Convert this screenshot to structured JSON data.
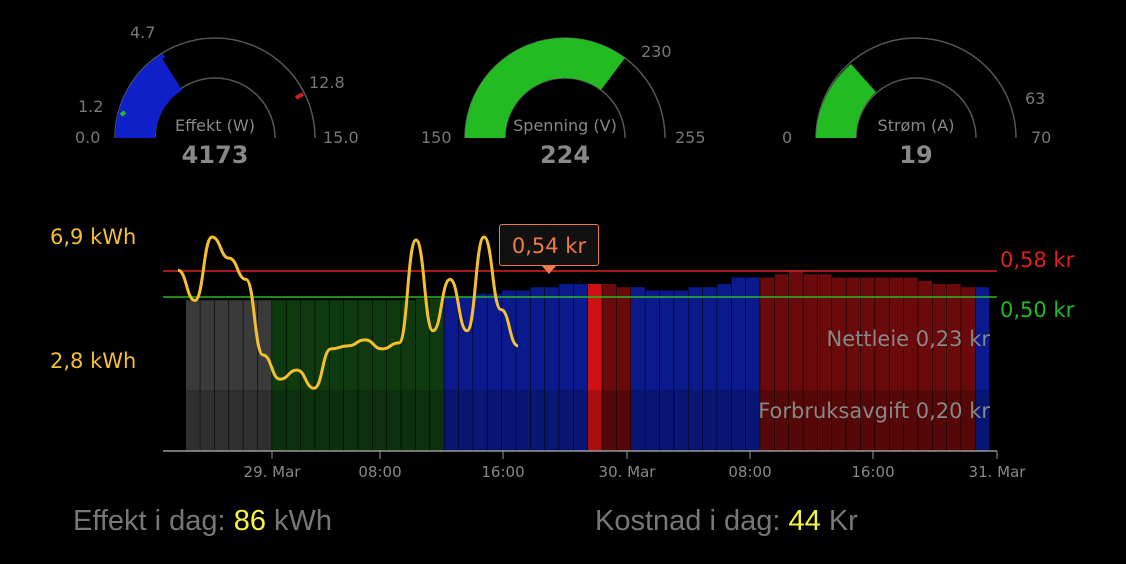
{
  "gauges": [
    {
      "name": "Effekt (W)",
      "value": "4173",
      "min_label": "0.0",
      "max_label": "15.0",
      "ticks": [
        "1.2",
        "4.7",
        "12.8"
      ],
      "fill_fraction": 0.278,
      "color": "#1020c8"
    },
    {
      "name": "Spenning (V)",
      "value": "224",
      "min_label": "150",
      "max_label": "255",
      "ticks": [
        "230"
      ],
      "fill_fraction": 0.705,
      "color": "#22bb22"
    },
    {
      "name": "Strøm (A)",
      "value": "19",
      "min_label": "0",
      "max_label": "70",
      "ticks": [
        "63"
      ],
      "fill_fraction": 0.271,
      "color": "#22bb22"
    }
  ],
  "chart_data": {
    "type": "bar",
    "y_labels_left": [
      "6,9 kWh",
      "2,8 kWh"
    ],
    "price_lines": [
      {
        "label": "0,58 kr",
        "value": 0.58,
        "color": "#e02020"
      },
      {
        "label": "0,50 kr",
        "value": 0.5,
        "color": "#22bb22"
      }
    ],
    "tooltip": "0,54 kr",
    "stack_labels": [
      "Nettleie 0,23 kr",
      "Forbruksavgift 0,20 kr"
    ],
    "x_ticks": [
      "29. Mar",
      "08:00",
      "16:00",
      "30. Mar",
      "08:00",
      "16:00",
      "31. Mar"
    ],
    "price_bars": [
      0.49,
      0.49,
      0.49,
      0.49,
      0.49,
      0.49,
      0.49,
      0.49,
      0.49,
      0.49,
      0.49,
      0.49,
      0.49,
      0.49,
      0.49,
      0.49,
      0.495,
      0.495,
      0.5,
      0.5,
      0.51,
      0.51,
      0.52,
      0.52,
      0.53,
      0.53,
      0.54,
      0.54,
      0.54,
      0.54,
      0.53,
      0.53,
      0.52,
      0.52,
      0.52,
      0.53,
      0.53,
      0.54,
      0.56,
      0.56,
      0.56,
      0.57,
      0.58,
      0.57,
      0.57,
      0.56,
      0.56,
      0.56,
      0.56,
      0.56,
      0.56,
      0.55,
      0.54,
      0.54,
      0.53,
      0.53
    ],
    "bar_colors": [
      "gray",
      "gray",
      "gray",
      "gray",
      "gray",
      "gray",
      "green",
      "green",
      "green",
      "green",
      "green",
      "green",
      "green",
      "green",
      "green",
      "green",
      "green",
      "green",
      "blue",
      "blue",
      "blue",
      "blue",
      "blue",
      "blue",
      "blue",
      "blue",
      "blue",
      "blue",
      "red-hl",
      "red",
      "red",
      "blue",
      "blue",
      "blue",
      "blue",
      "blue",
      "blue",
      "blue",
      "blue",
      "blue",
      "red",
      "red",
      "red",
      "red",
      "red",
      "red",
      "red",
      "red",
      "red",
      "red",
      "red",
      "red",
      "red",
      "red",
      "red",
      "blue"
    ],
    "consumption_kwh": [
      5.8,
      4.8,
      6.9,
      6.2,
      5.5,
      3.0,
      2.2,
      2.5,
      1.9,
      3.2,
      3.3,
      3.5,
      3.2,
      3.4,
      6.8,
      3.8,
      5.5,
      3.8,
      6.9,
      4.5,
      3.3
    ]
  },
  "footer": {
    "left_label": "Effekt i dag:",
    "left_value": "86",
    "left_unit": "kWh",
    "right_label": "Kostnad i dag:",
    "right_value": "44",
    "right_unit": "Kr"
  }
}
